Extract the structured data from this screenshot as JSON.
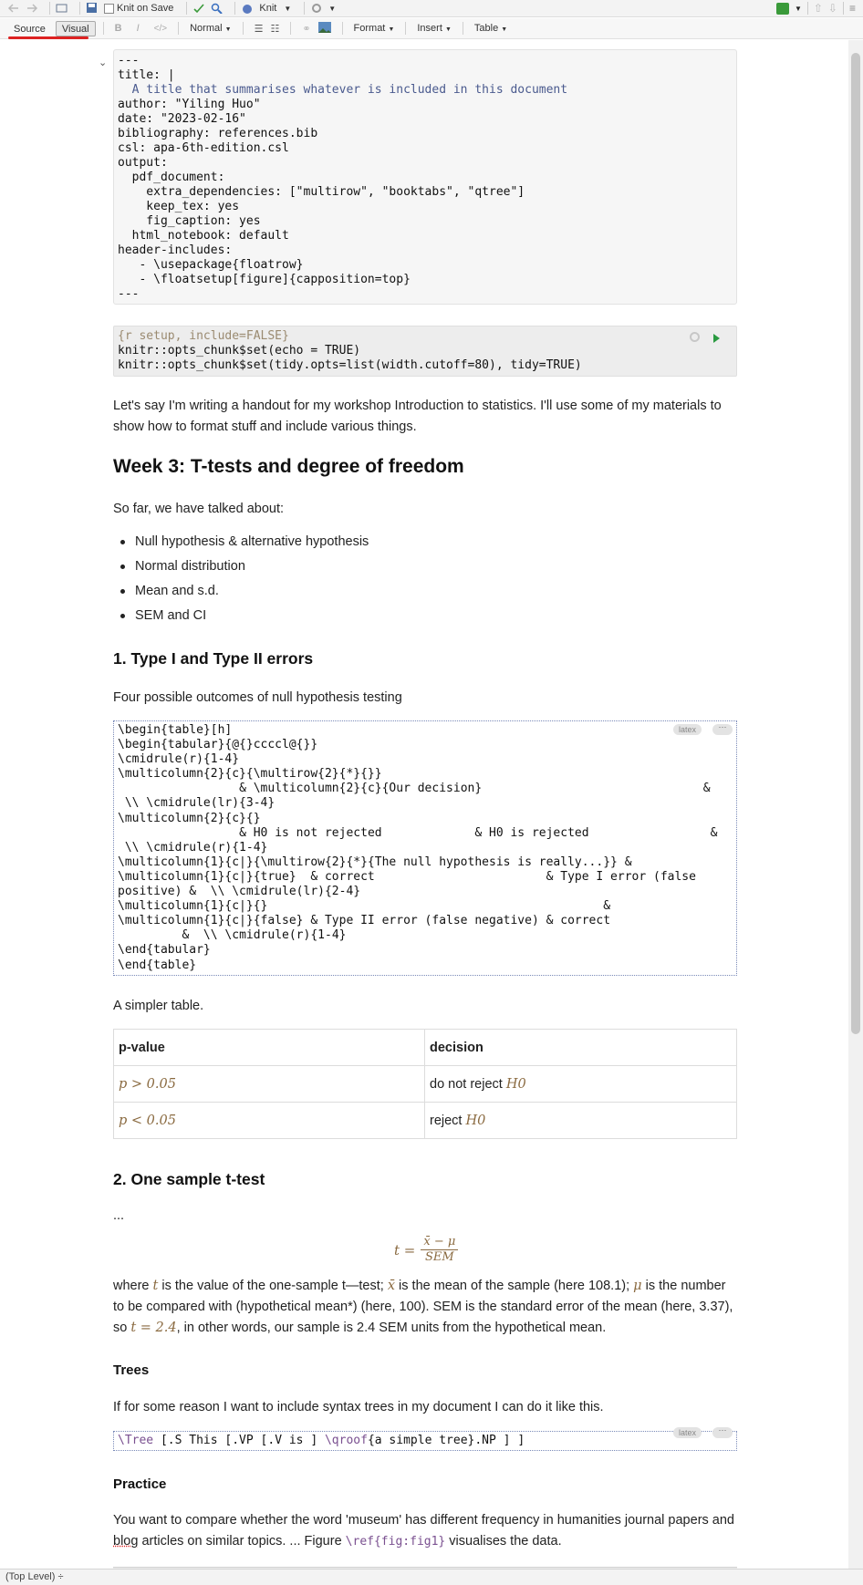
{
  "toolbar": {
    "knit_on_save": "Knit on Save",
    "knit": "Knit"
  },
  "format_bar": {
    "source": "Source",
    "visual": "Visual",
    "bold": "B",
    "italic": "I",
    "code": "</>",
    "style": "Normal",
    "format": "Format",
    "insert": "Insert",
    "table": "Table"
  },
  "yaml": {
    "l1": "---",
    "l2": "title: |",
    "l3": "  A title that summarises whatever is included in this document",
    "l4": "author: \"Yiling Huo\"",
    "l5": "date: \"2023-02-16\"",
    "l6": "bibliography: references.bib",
    "l7": "csl: apa-6th-edition.csl",
    "l8": "output:",
    "l9": "  pdf_document:",
    "l10": "    extra_dependencies: [\"multirow\", \"booktabs\", \"qtree\"]",
    "l11": "    keep_tex: yes",
    "l12": "    fig_caption: yes",
    "l13": "  html_notebook: default",
    "l14": "header-includes:",
    "l15": "   - \\usepackage{floatrow}",
    "l16": "   - \\floatsetup[figure]{capposition=top}",
    "l17": "---"
  },
  "rchunk": {
    "header": "{r setup, include=FALSE}",
    "l2": "knitr::opts_chunk$set(echo = TRUE)",
    "l3": "knitr::opts_chunk$set(tidy.opts=list(width.cutoff=80), tidy=TRUE)"
  },
  "intro": "Let's say I'm writing a handout for my workshop Introduction to statistics. I'll use some of my materials to show how to format stuff and include various things.",
  "week_heading": "Week 3: T-tests and degree of freedom",
  "so_far": "So far, we have talked about:",
  "bullets": [
    "Null hypothesis & alternative hypothesis",
    "Normal distribution",
    "Mean and s.d.",
    "SEM and CI"
  ],
  "section1": "1. Type I and Type II errors",
  "four_outcomes": "Four possible outcomes of null hypothesis testing",
  "latex_tag": "latex",
  "more": "···",
  "latex_table": "\\begin{table}[h]\n\\begin{tabular}{@{}ccccl@{}}\n\\cmidrule(r){1-4}\n\\multicolumn{2}{c}{\\multirow{2}{*}{}}\n                 & \\multicolumn{2}{c}{Our decision}                               &\n \\\\ \\cmidrule(lr){3-4}\n\\multicolumn{2}{c}{}\n                 & H0 is not rejected             & H0 is rejected                 &\n \\\\ \\cmidrule(r){1-4}\n\\multicolumn{1}{c|}{\\multirow{2}{*}{The null hypothesis is really...}} &\n\\multicolumn{1}{c|}{true}  & correct                        & Type I error (false\npositive) &  \\\\ \\cmidrule(lr){2-4}\n\\multicolumn{1}{c|}{}                                               &\n\\multicolumn{1}{c|}{false} & Type II error (false negative) & correct\n         &  \\\\ \\cmidrule(r){1-4}\n\\end{tabular}\n\\end{table}",
  "simpler": "A simpler table.",
  "simple_table": {
    "headers": [
      "p-value",
      "decision"
    ],
    "rows": [
      {
        "p": "p > 0.05",
        "d_text": "do not reject",
        "d_math": "H0"
      },
      {
        "p": "p < 0.05",
        "d_text": "reject",
        "d_math": "H0"
      }
    ]
  },
  "section2": "2. One sample t-test",
  "ellipsis": "...",
  "formula": {
    "lhs": "t =",
    "num": "x̄ − μ",
    "den": "SEM"
  },
  "where_parts": {
    "a": " where ",
    "t": "t",
    "b": " is the value of the one-sample t—test; ",
    "xbar": "x̄",
    "c": " is the mean of the sample (here 108.1); ",
    "mu": "μ",
    "d": " is the number to be compared with (hypothetical mean*) (here, 100). SEM is the standard error of the mean (here, 3.37), so ",
    "t24": "t = 2.4",
    "e": ", in other words, our sample is 2.4 SEM units from the hypothetical mean."
  },
  "trees_heading": "Trees",
  "trees_text": "If for some reason I want to include syntax trees in my document I can do it like this.",
  "tree_code_cmd": "\\Tree",
  "tree_code_a": " [.S This [.VP [.V is ] ",
  "tree_code_cmd2": "\\qroof",
  "tree_code_b": "{a simple tree}.NP ] ]",
  "practice_heading": "Practice",
  "practice": {
    "a": "You want to compare whether the word 'museum' has different frequency in humanities journal papers and ",
    "blog": "blog",
    "b": " articles on similar topics. ... Figure ",
    "ref": "\\ref{fig:fig1}",
    "c": " visualises the data."
  },
  "status": "(Top Level) ÷"
}
